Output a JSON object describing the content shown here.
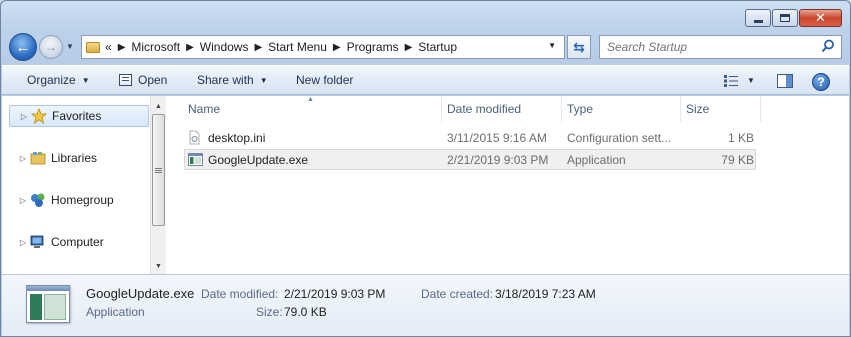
{
  "window": {
    "caption": {
      "minimize": "minimize",
      "maximize": "maximize",
      "close": "✕"
    }
  },
  "address": {
    "overflow": "«",
    "crumbs": [
      "Microsoft",
      "Windows",
      "Start Menu",
      "Programs",
      "Startup"
    ]
  },
  "search": {
    "placeholder": "Search Startup"
  },
  "toolbar": {
    "organize": "Organize",
    "open": "Open",
    "share_with": "Share with",
    "new_folder": "New folder"
  },
  "sidebar": {
    "items": [
      {
        "label": "Favorites",
        "icon": "star-icon"
      },
      {
        "label": "Libraries",
        "icon": "libraries-icon"
      },
      {
        "label": "Homegroup",
        "icon": "homegroup-icon"
      },
      {
        "label": "Computer",
        "icon": "computer-icon"
      }
    ]
  },
  "columns": {
    "name": "Name",
    "date": "Date modified",
    "type": "Type",
    "size": "Size"
  },
  "files": [
    {
      "name": "desktop.ini",
      "date": "3/11/2015 9:16 AM",
      "type": "Configuration sett...",
      "size": "1 KB",
      "icon": "ini-file-icon"
    },
    {
      "name": "GoogleUpdate.exe",
      "date": "2/21/2019 9:03 PM",
      "type": "Application",
      "size": "79 KB",
      "icon": "exe-file-icon"
    }
  ],
  "details": {
    "name": "GoogleUpdate.exe",
    "type": "Application",
    "date_modified_label": "Date modified:",
    "date_modified": "2/21/2019 9:03 PM",
    "date_created_label": "Date created:",
    "date_created": "3/18/2019 7:23 AM",
    "size_label": "Size:",
    "size": "79.0 KB"
  },
  "colors": {
    "accent": "#1d55a8",
    "selection": "#d7e8fa",
    "close": "#c9462c"
  }
}
